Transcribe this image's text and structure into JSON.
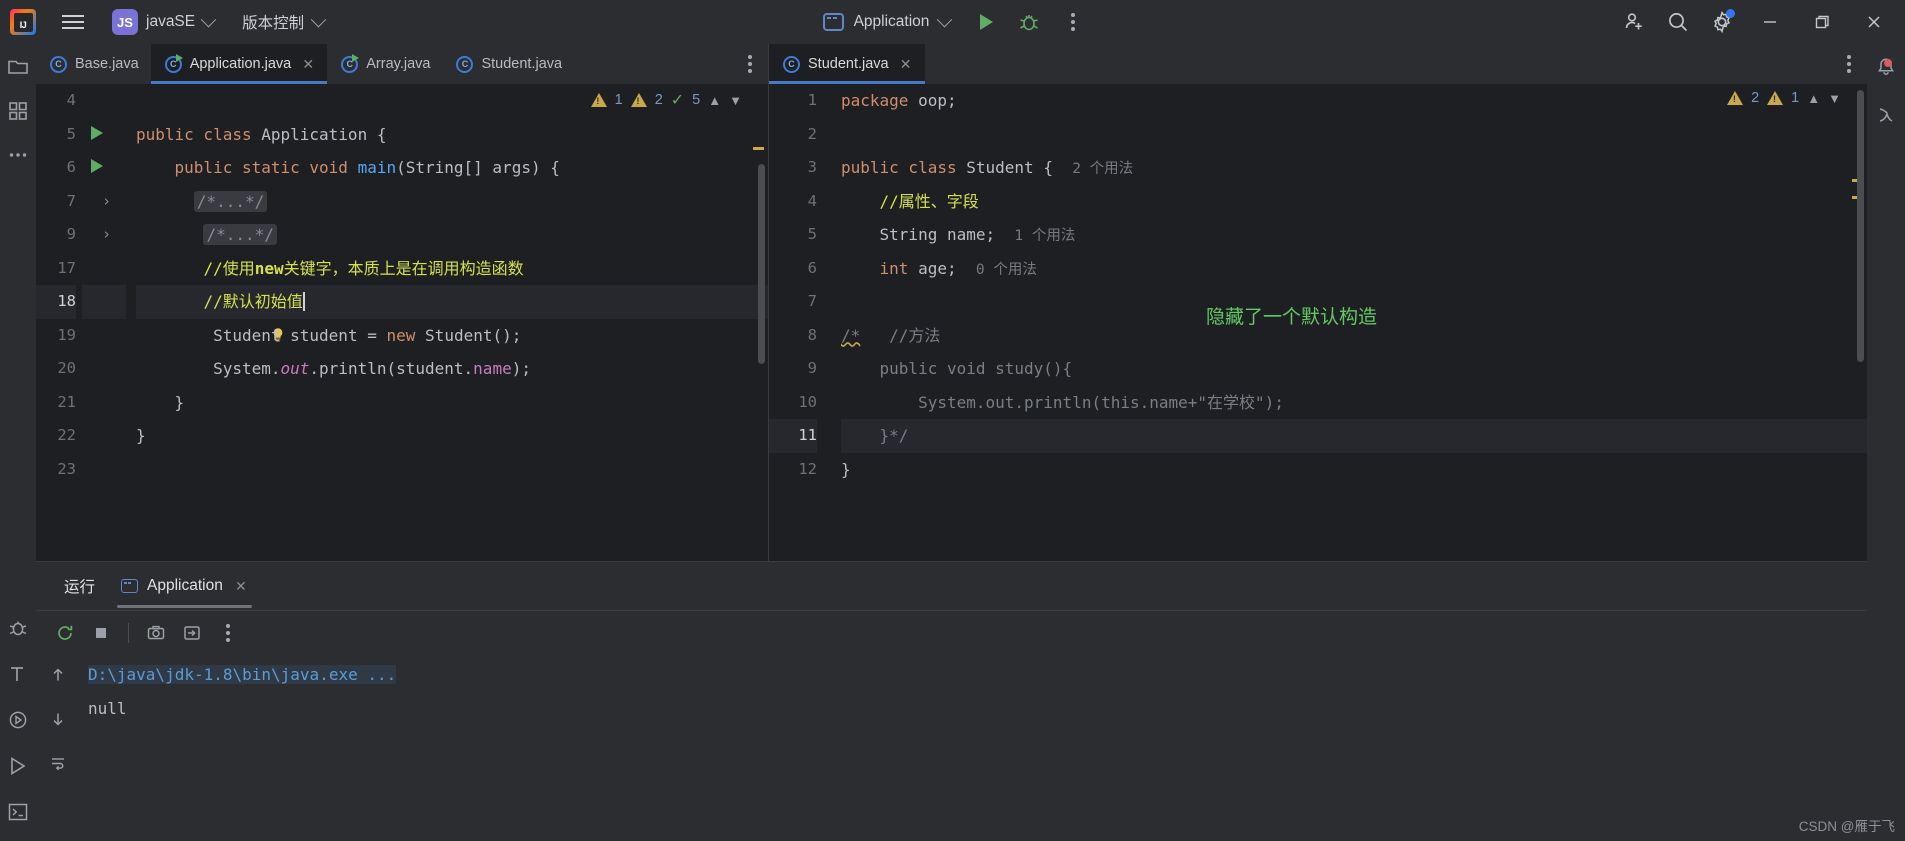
{
  "titlebar": {
    "menu_icon": "hamburger-icon",
    "project_badge": "JS",
    "project_name": "javaSE",
    "vcs_label": "版本控制",
    "run_config": "Application",
    "run_icon": "run-icon",
    "debug_icon": "debug-icon",
    "more_icon": "more-vertical-icon",
    "add_user_icon": "add-user-icon",
    "search_icon": "search-icon",
    "settings_icon": "settings-gear-icon",
    "minimize": "—",
    "maximize": "❐",
    "close": "✕"
  },
  "left_pane": {
    "tabs": [
      {
        "label": "Base.java",
        "icon": "java-class-icon",
        "active": false,
        "closable": false,
        "runnable": false
      },
      {
        "label": "Application.java",
        "icon": "java-class-runnable-icon",
        "active": true,
        "closable": true,
        "runnable": true
      },
      {
        "label": "Array.java",
        "icon": "java-class-runnable-icon",
        "active": false,
        "closable": false,
        "runnable": true
      },
      {
        "label": "Student.java",
        "icon": "java-class-icon",
        "active": false,
        "closable": false,
        "runnable": false
      }
    ],
    "inspect": {
      "error_count": "1",
      "warning_count": "2",
      "ok_count": "5"
    },
    "lines": [
      {
        "num": "4",
        "text": ""
      },
      {
        "num": "5",
        "text": "public class Application {"
      },
      {
        "num": "6",
        "text": "    public static void main(String[] args) {"
      },
      {
        "num": "7",
        "text": "        /*...*/"
      },
      {
        "num": "9",
        "text": "         /*...*/"
      },
      {
        "num": "17",
        "text": "        //使用new关键字，本质上是在调用构造函数"
      },
      {
        "num": "18",
        "text": "        //默认初始值"
      },
      {
        "num": "19",
        "text": "        Student student = new Student();"
      },
      {
        "num": "20",
        "text": "        System.out.println(student.name);"
      },
      {
        "num": "21",
        "text": "    }"
      },
      {
        "num": "22",
        "text": "}"
      },
      {
        "num": "23",
        "text": ""
      }
    ]
  },
  "right_pane": {
    "tabs": [
      {
        "label": "Student.java",
        "icon": "java-class-icon",
        "active": true,
        "closable": true
      }
    ],
    "inspect": {
      "error_count": "2",
      "warning_count": "1"
    },
    "annotation": "隐藏了一个默认构造",
    "lines": [
      {
        "num": "1",
        "text": "package oop;"
      },
      {
        "num": "2",
        "text": ""
      },
      {
        "num": "3",
        "text": "public class Student {",
        "hint": "2 个用法"
      },
      {
        "num": "4",
        "text": "    //属性、字段"
      },
      {
        "num": "5",
        "text": "    String name;",
        "hint": "1 个用法"
      },
      {
        "num": "6",
        "text": "    int age;",
        "hint": "0 个用法"
      },
      {
        "num": "7",
        "text": ""
      },
      {
        "num": "8",
        "text": "/*   //方法"
      },
      {
        "num": "9",
        "text": "    public void study(){"
      },
      {
        "num": "10",
        "text": "        System.out.println(this.name+\"在学校\");"
      },
      {
        "num": "11",
        "text": "    }*/"
      },
      {
        "num": "12",
        "text": "}"
      }
    ]
  },
  "run_panel": {
    "title": "运行",
    "tab_label": "Application",
    "tab_icon": "run-config-icon",
    "toolbar": [
      {
        "icon": "rerun-icon",
        "name": "rerun-button"
      },
      {
        "icon": "stop-icon",
        "name": "stop-button"
      },
      {
        "icon": "camera-icon",
        "name": "screenshot-button"
      },
      {
        "icon": "export-icon",
        "name": "export-button"
      },
      {
        "icon": "more-vertical-icon",
        "name": "more-button"
      }
    ],
    "side_icons": [
      {
        "icon": "arrow-up-icon",
        "name": "scroll-up-button"
      },
      {
        "icon": "arrow-down-icon",
        "name": "scroll-down-button"
      },
      {
        "icon": "soft-wrap-icon",
        "name": "soft-wrap-button"
      }
    ],
    "console": [
      {
        "text": "D:\\java\\jdk-1.8\\bin\\java.exe ...",
        "style": "command"
      },
      {
        "text": "null",
        "style": "output"
      }
    ]
  },
  "left_rail": {
    "items": [
      {
        "icon": "project-folder-icon",
        "name": "project-tool-window"
      },
      {
        "icon": "structure-icon",
        "name": "structure-tool-window"
      },
      {
        "icon": "more-dots-icon",
        "name": "more-tool-windows"
      }
    ],
    "bottom_items": [
      {
        "icon": "debug-icon",
        "name": "debug-tool-window"
      },
      {
        "icon": "terminal-text-icon",
        "name": "todo-tool-window"
      },
      {
        "icon": "services-icon",
        "name": "services-tool-window"
      },
      {
        "icon": "run-icon",
        "name": "run-tool-window"
      },
      {
        "icon": "terminal-icon",
        "name": "terminal-tool-window"
      }
    ]
  },
  "right_rail": {
    "items": [
      {
        "icon": "notifications-bell-icon",
        "name": "notifications-button"
      },
      {
        "icon": "ai-assistant-icon",
        "name": "ai-assistant-button"
      }
    ]
  },
  "watermark": "CSDN @雁于飞",
  "colors": {
    "accent_blue": "#4779c4",
    "warning": "#c9a84c",
    "success": "#5fad65",
    "comment": "#d5e04a",
    "annotation_green": "#63c963",
    "keyword": "#cf8e6d",
    "method": "#56a8f5",
    "background": "#1e1f22",
    "chrome": "#2b2d30"
  }
}
